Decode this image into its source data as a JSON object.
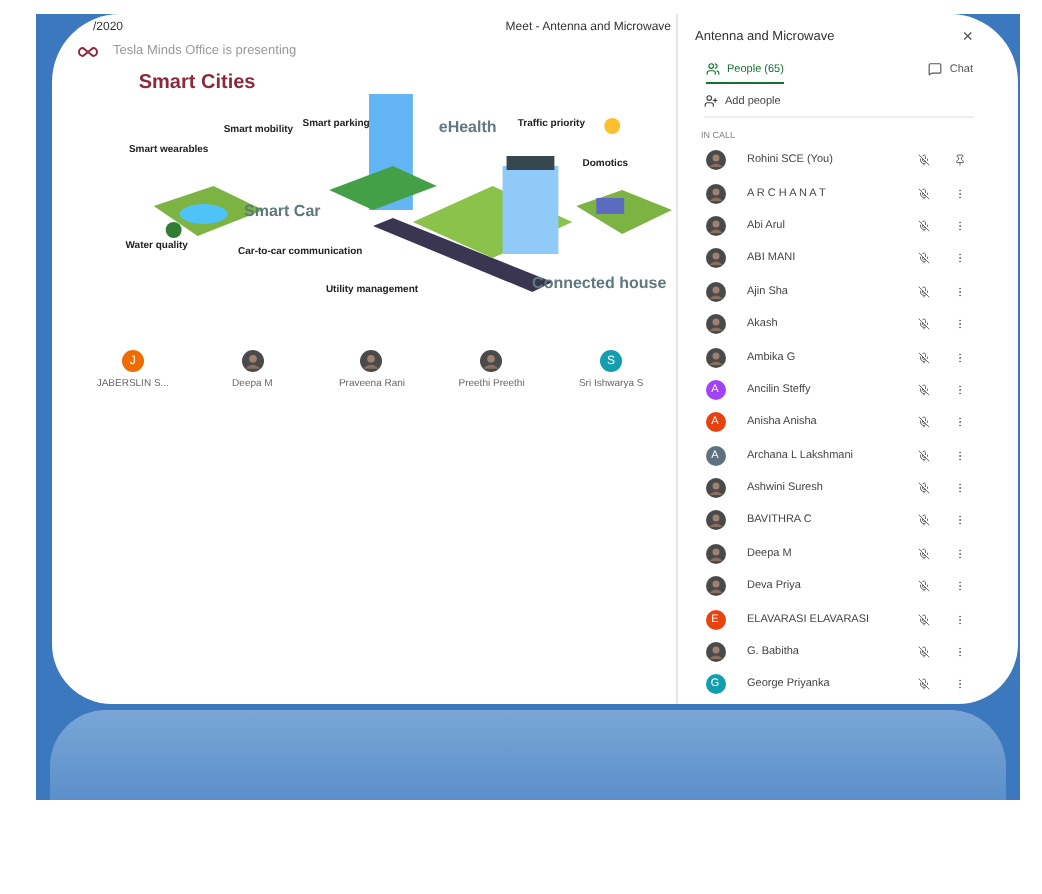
{
  "meeting": {
    "date": "/2020",
    "title": "Meet - Antenna and Microwave",
    "presenting": "Tesla Minds Office is presenting"
  },
  "slide": {
    "title": "Smart Cities",
    "labels": [
      {
        "text": "Smart wearables"
      },
      {
        "text": "Smart mobility"
      },
      {
        "text": "Smart parking"
      },
      {
        "text": "eHealth",
        "kind": "big"
      },
      {
        "text": "Traffic priority"
      },
      {
        "text": "Domotics"
      },
      {
        "text": "Smart Car",
        "kind": "big"
      },
      {
        "text": "Water quality"
      },
      {
        "text": "Car-to-car communication"
      },
      {
        "text": "Utility management"
      },
      {
        "text": "Connected house",
        "kind": "big"
      }
    ]
  },
  "tiles": [
    {
      "name": "JABERSLIN S...",
      "kind": "letter",
      "letter": "J",
      "color": "#ef6c00"
    },
    {
      "name": "Deepa M"
    },
    {
      "name": "Praveena Rani"
    },
    {
      "name": "Preethi Preethi"
    },
    {
      "name": "Sri Ishwarya S",
      "kind": "letter",
      "letter": "S",
      "color": "#129eaf"
    }
  ],
  "panel": {
    "title": "Antenna and Microwave",
    "close": "×",
    "tabs": [
      {
        "label": "People (65)",
        "kind": "people",
        "selected": true
      },
      {
        "label": "Chat",
        "kind": "chat",
        "selected": false
      }
    ],
    "add": "Add people",
    "section": "IN CALL",
    "people": [
      {
        "name": "Rohini SCE (You)",
        "pinned": true
      },
      {
        "name": "A R C H A N A T",
        "pinned": false
      },
      {
        "name": "Abi Arul",
        "pinned": false
      },
      {
        "name": "ABI MANI",
        "pinned": false
      },
      {
        "name": "Ajin Sha",
        "pinned": false
      },
      {
        "name": "Akash",
        "pinned": false
      },
      {
        "name": "Ambika G",
        "pinned": false
      },
      {
        "name": "Ancilin Steffy",
        "kind": "letter",
        "letter": "A",
        "color": "#a142f4",
        "pinned": false
      },
      {
        "name": "Anisha Anisha",
        "kind": "letter",
        "letter": "A",
        "color": "#e8430e",
        "pinned": false
      },
      {
        "name": "Archana L Lakshmani",
        "kind": "letter",
        "letter": "A",
        "color": "#5f7080",
        "pinned": false
      },
      {
        "name": "Ashwini Suresh",
        "pinned": false
      },
      {
        "name": "BAVITHRA C",
        "pinned": false
      },
      {
        "name": "Deepa M",
        "pinned": false
      },
      {
        "name": "Deva Priya",
        "pinned": false
      },
      {
        "name": "ELAVARASI ELAVARASI",
        "kind": "letter",
        "letter": "E",
        "color": "#e8430e",
        "pinned": false
      },
      {
        "name": "G. Babitha",
        "pinned": false
      },
      {
        "name": "George Priyanka",
        "kind": "letter",
        "letter": "G",
        "color": "#129eaf",
        "pinned": false
      }
    ]
  }
}
